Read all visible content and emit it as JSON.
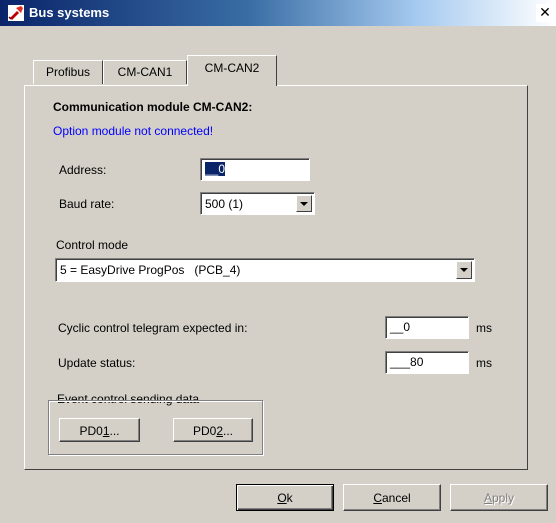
{
  "window": {
    "title": "Bus systems",
    "close_glyph": "✕",
    "titlebar_colors": {
      "start": "#0a246a",
      "end": "#a6caf0"
    },
    "app_icon": "tool-icon"
  },
  "tabs": [
    {
      "label": "Profibus",
      "active": false
    },
    {
      "label": "CM-CAN1",
      "active": false
    },
    {
      "label": "CM-CAN2",
      "active": true
    }
  ],
  "panel": {
    "heading": "Communication module CM-CAN2:",
    "status": "Option module not connected!",
    "status_color": "#0000ff",
    "address": {
      "label": "Address:",
      "value": "__0"
    },
    "baud_rate": {
      "label": "Baud rate:",
      "value": "500 (1)"
    },
    "control_mode": {
      "label": "Control mode",
      "value": "5 = EasyDrive ProgPos   (PCB_4)"
    },
    "cyclic": {
      "label": "Cyclic control telegram expected in:",
      "value": "__0",
      "unit": "ms"
    },
    "update_status": {
      "label": "Update status:",
      "value": "___80",
      "unit": "ms"
    },
    "event_group": {
      "title": "Event control sending data",
      "pd01": {
        "prefix": "PD0",
        "mnemonic": "1",
        "suffix": "..."
      },
      "pd02": {
        "prefix": "PD0",
        "mnemonic": "2",
        "suffix": "..."
      }
    }
  },
  "footer": {
    "ok": {
      "mnemonic": "O",
      "rest": "k"
    },
    "cancel": {
      "mnemonic": "C",
      "rest": "ancel"
    },
    "apply": {
      "mnemonic": "A",
      "rest": "pply",
      "disabled": true
    }
  }
}
